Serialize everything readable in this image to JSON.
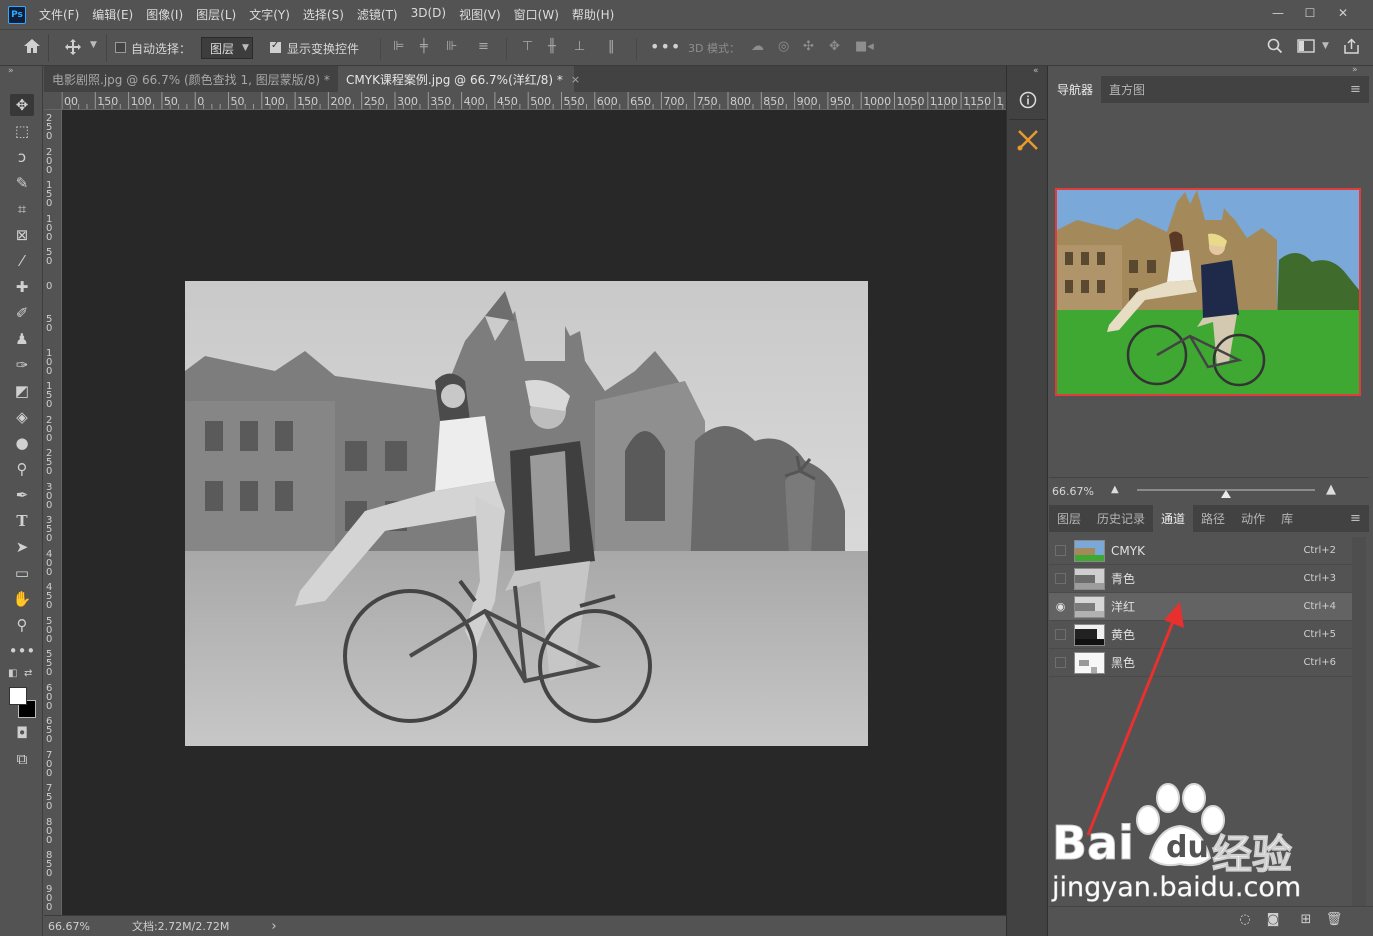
{
  "app": {
    "logo": "Ps"
  },
  "menu": [
    "文件(F)",
    "编辑(E)",
    "图像(I)",
    "图层(L)",
    "文字(Y)",
    "选择(S)",
    "滤镜(T)",
    "3D(D)",
    "视图(V)",
    "窗口(W)",
    "帮助(H)"
  ],
  "options": {
    "auto_select_label": "自动选择：",
    "auto_select_checked": false,
    "target_value": "图层",
    "show_transform_label": "显示变换控件",
    "show_transform_checked": true,
    "mode3d_label": "3D 模式："
  },
  "tabs": [
    {
      "label": "电影剧照.jpg @ 66.7% (颜色查找 1, 图层蒙版/8) *",
      "active": false
    },
    {
      "label": "CMYK课程案例.jpg @ 66.7%(洋红/8) *",
      "active": true
    }
  ],
  "ruler_h": [
    "00",
    "150",
    "100",
    "50",
    "0",
    "50",
    "100",
    "150",
    "200",
    "250",
    "300",
    "350",
    "400",
    "450",
    "500",
    "550",
    "600",
    "650",
    "700",
    "750",
    "800",
    "850",
    "900",
    "950",
    "1000",
    "1050",
    "1100",
    "1150",
    "1"
  ],
  "ruler_v": [
    "250",
    "200",
    "150",
    "100",
    "50",
    "0",
    "50",
    "100",
    "150",
    "200",
    "250",
    "300",
    "350",
    "400",
    "450",
    "500",
    "550",
    "600",
    "650",
    "700",
    "750",
    "800",
    "850",
    "900"
  ],
  "status": {
    "zoom": "66.67%",
    "doc": "文档:2.72M/2.72M",
    "arrow": "›"
  },
  "navigator": {
    "tabs": [
      "导航器",
      "直方图"
    ],
    "active": 0,
    "zoom": "66.67%",
    "slider_value": 0.5
  },
  "channels_panel": {
    "tabs": [
      "图层",
      "历史记录",
      "通道",
      "路径",
      "动作",
      "库"
    ],
    "active": 2,
    "channels": [
      {
        "name": "CMYK",
        "shortcut": "Ctrl+2",
        "visible": false,
        "selected": false
      },
      {
        "name": "青色",
        "shortcut": "Ctrl+3",
        "visible": false,
        "selected": false
      },
      {
        "name": "洋红",
        "shortcut": "Ctrl+4",
        "visible": true,
        "selected": true
      },
      {
        "name": "黄色",
        "shortcut": "Ctrl+5",
        "visible": false,
        "selected": false
      },
      {
        "name": "黑色",
        "shortcut": "Ctrl+6",
        "visible": false,
        "selected": false
      }
    ]
  },
  "watermark": {
    "brand": "Bai",
    "brand2": "du",
    "label": "经验",
    "url": "jingyan.baidu.com"
  },
  "colors": {
    "accent_red": "#e23b3b",
    "canvas_bg": "#282828",
    "panel_bg": "#535353",
    "dark_bg": "#424242"
  }
}
